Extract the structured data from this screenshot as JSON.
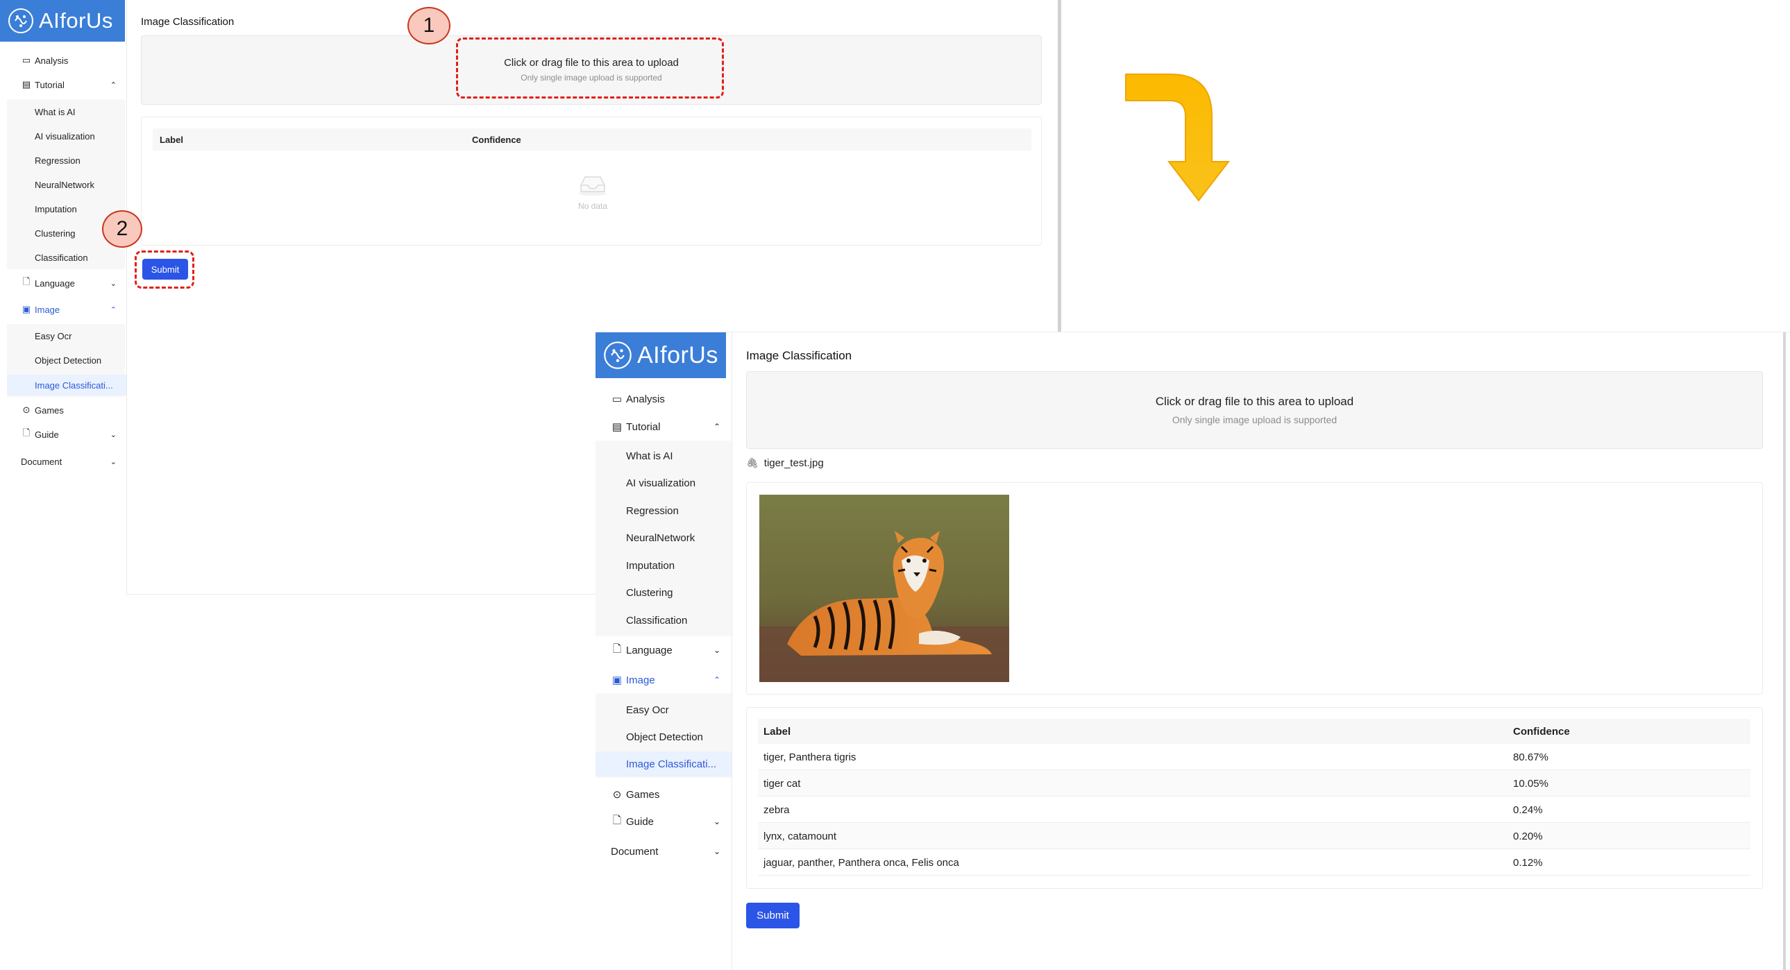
{
  "brand": {
    "name": "AIforUs"
  },
  "menu": {
    "analysis": "Analysis",
    "tutorial": "Tutorial",
    "tutorial_items": [
      "What is AI",
      "AI visualization",
      "Regression",
      "NeuralNetwork",
      "Imputation",
      "Clustering",
      "Classification"
    ],
    "language": "Language",
    "image": "Image",
    "image_items": [
      "Easy Ocr",
      "Object Detection",
      "Image Classificati..."
    ],
    "games": "Games",
    "guide": "Guide",
    "document": "Document"
  },
  "page": {
    "title": "Image Classification",
    "upload_main": "Click or drag file to this area to upload",
    "upload_hint": "Only single image upload is supported",
    "submit": "Submit",
    "empty_text": "No data",
    "col_label": "Label",
    "col_confidence": "Confidence"
  },
  "after": {
    "file_name": "tiger_test.jpg",
    "results": [
      {
        "label": "tiger, Panthera tigris",
        "confidence": "80.67%"
      },
      {
        "label": "tiger cat",
        "confidence": "10.05%"
      },
      {
        "label": "zebra",
        "confidence": "0.24%"
      },
      {
        "label": "lynx, catamount",
        "confidence": "0.20%"
      },
      {
        "label": "jaguar, panther, Panthera onca, Felis onca",
        "confidence": "0.12%"
      }
    ]
  },
  "steps": {
    "one": "1",
    "two": "2"
  },
  "colors": {
    "accent": "#2b55e6",
    "logo": "#3b7ed8",
    "arrow": "#f7b500",
    "highlight": "#e0201a"
  }
}
